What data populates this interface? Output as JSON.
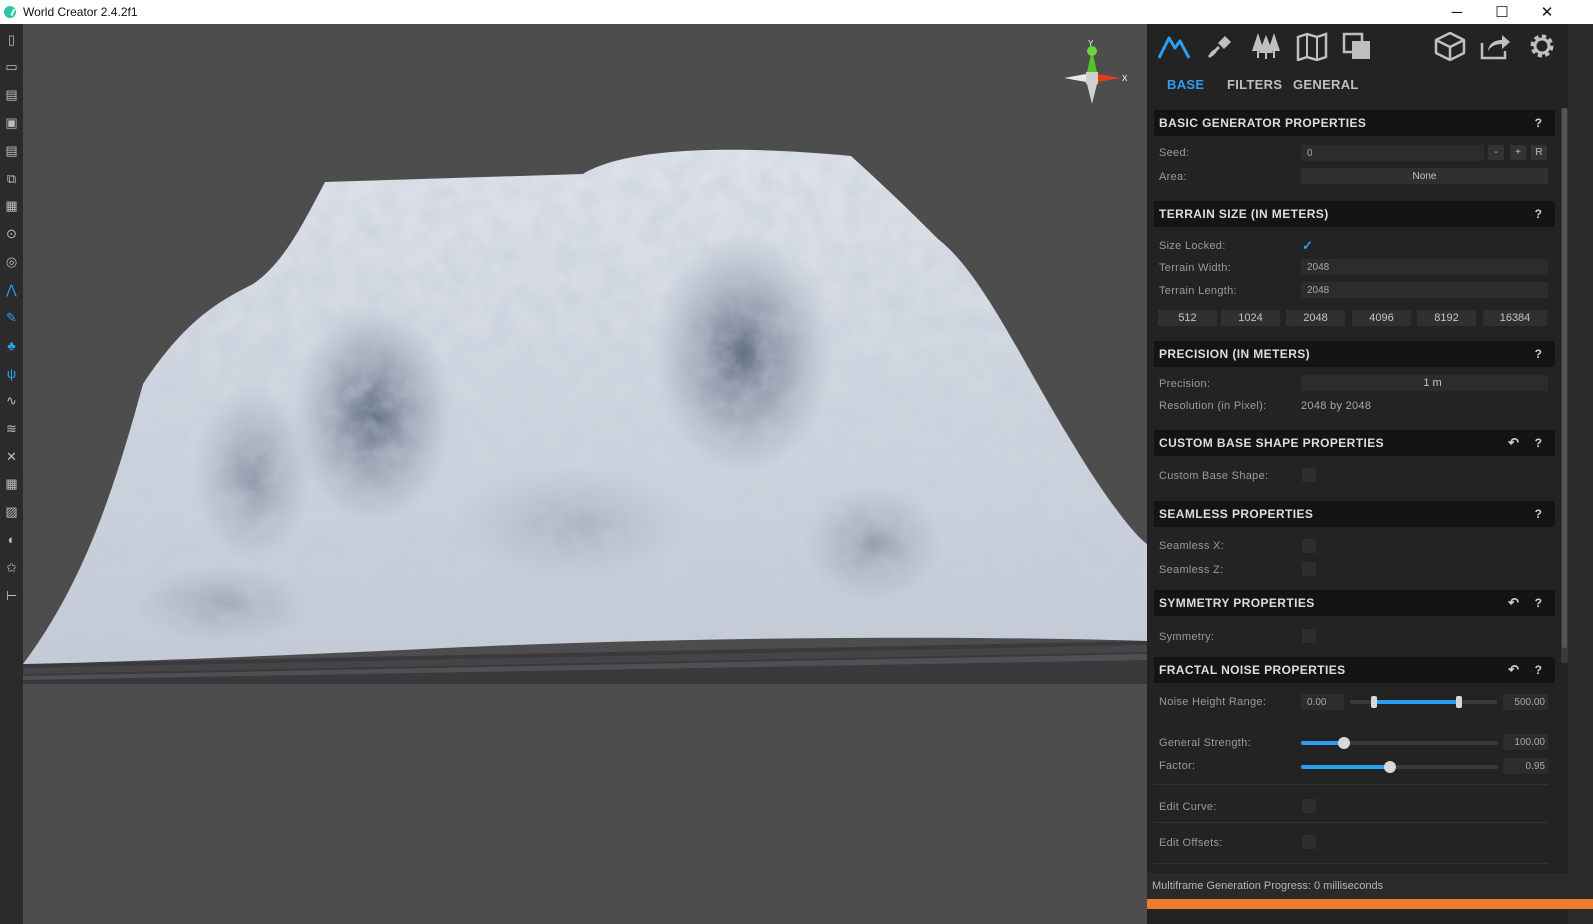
{
  "window": {
    "title": "World Creator 2.4.2f1",
    "minimize": "─",
    "maximize": "☐",
    "close": "✕"
  },
  "colors": {
    "accent": "#2a9ff0",
    "progress": "#ee7a2c",
    "panel": "#232323"
  },
  "left_toolbar": [
    {
      "name": "new-file-icon"
    },
    {
      "name": "open-folder-icon"
    },
    {
      "name": "open-recent-icon"
    },
    {
      "name": "save-icon"
    },
    {
      "name": "save-as-icon"
    },
    {
      "name": "import-icon"
    },
    {
      "name": "map-icon"
    },
    {
      "name": "binoculars-icon"
    },
    {
      "name": "globe-icon"
    },
    {
      "name": "terrain-icon"
    },
    {
      "name": "brush-icon"
    },
    {
      "name": "trees-icon"
    },
    {
      "name": "grass-icon"
    },
    {
      "name": "path-icon"
    },
    {
      "name": "erosion-icon"
    },
    {
      "name": "transform-icon"
    },
    {
      "name": "grid-icon"
    },
    {
      "name": "image-icon"
    },
    {
      "name": "sphere-icon"
    },
    {
      "name": "star-icon"
    },
    {
      "name": "tools-icon"
    }
  ],
  "gizmo": {
    "y": "Y",
    "x": "X"
  },
  "panel": {
    "tabs": [
      {
        "label": "BASE"
      },
      {
        "label": "FILTERS"
      },
      {
        "label": "GENERAL"
      }
    ],
    "basic": {
      "title": "BASIC GENERATOR PROPERTIES",
      "help": "?",
      "seed_label": "Seed:",
      "seed_value": "0",
      "seed_minus": "-",
      "seed_plus": "+",
      "seed_reset": "R",
      "area_label": "Area:",
      "area_value": "None"
    },
    "terrain_size": {
      "title": "TERRAIN SIZE (IN METERS)",
      "help": "?",
      "locked_label": "Size Locked:",
      "locked_mark": "✓",
      "width_label": "Terrain Width:",
      "width_value": "2048",
      "length_label": "Terrain Length:",
      "length_value": "2048",
      "presets": [
        "512",
        "1024",
        "2048",
        "4096",
        "8192",
        "16384"
      ]
    },
    "precision": {
      "title": "PRECISION (IN METERS)",
      "help": "?",
      "precision_label": "Precision:",
      "precision_value": "1 m",
      "resolution_label": "Resolution (in Pixel):",
      "resolution_value": "2048 by 2048"
    },
    "custom_base": {
      "title": "CUSTOM BASE SHAPE PROPERTIES",
      "undo": "↶",
      "help": "?",
      "shape_label": "Custom Base Shape:"
    },
    "seamless": {
      "title": "SEAMLESS PROPERTIES",
      "help": "?",
      "x_label": "Seamless X:",
      "z_label": "Seamless Z:"
    },
    "symmetry": {
      "title": "SYMMETRY PROPERTIES",
      "undo": "↶",
      "help": "?",
      "symmetry_label": "Symmetry:"
    },
    "fractal": {
      "title": "FRACTAL NOISE PROPERTIES",
      "undo": "↶",
      "help": "?",
      "range_label": "Noise Height Range:",
      "range_min": "0.00",
      "range_max": "500.00",
      "range_low_fraction": 0.16,
      "range_high_fraction": 0.74,
      "strength_label": "General Strength:",
      "strength_value": "100.00",
      "strength_fraction": 0.22,
      "factor_label": "Factor:",
      "factor_value": "0.95",
      "factor_fraction": 0.45,
      "curve_label": "Edit Curve:",
      "offsets_label": "Edit Offsets:"
    }
  },
  "status": {
    "text": "Multiframe Generation Progress: 0 milliseconds"
  }
}
